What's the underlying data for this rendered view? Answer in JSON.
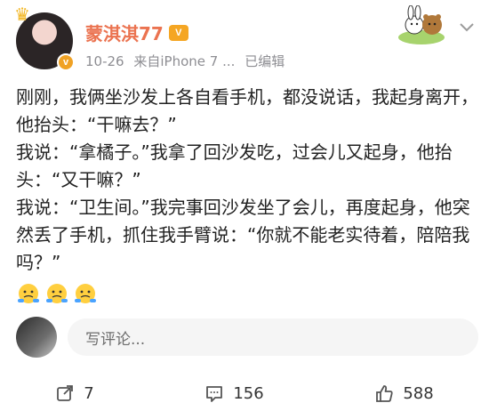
{
  "post": {
    "username": "蒙淇淇77",
    "date": "10-26",
    "source": "来自iPhone 7 ...",
    "edited": "已编辑",
    "content": [
      "刚刚，我俩坐沙发上各自看手机，都没说话，我起身离开，他抬头：“干嘛去？”",
      "我说：“拿橘子。”我拿了回沙发吃，过会儿又起身，他抬头：“又干嘛？”",
      "我说：“卫生间。”我完事回沙发坐了会儿，再度起身，他突然丢了手机，抓住我手臂说：“你就不能老实待着，陪陪我吗？”"
    ],
    "emojis": [
      "shrug-emoji",
      "shrug-emoji",
      "shrug-emoji"
    ]
  },
  "comment": {
    "placeholder": "写评论..."
  },
  "actions": {
    "repost_count": "7",
    "comment_count": "156",
    "like_count": "588"
  },
  "colors": {
    "username": "#eb7350",
    "vip": "#f5a623",
    "meta": "#8e8e93"
  }
}
